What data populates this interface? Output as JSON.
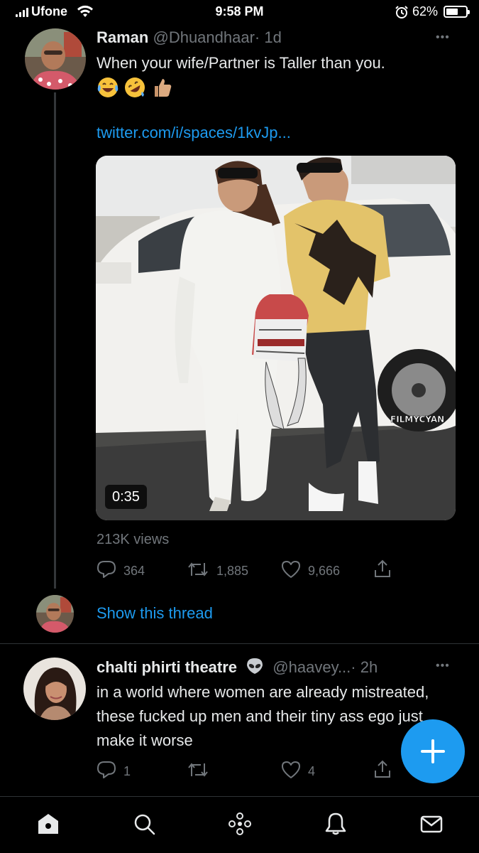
{
  "status_bar": {
    "carrier": "Ufone",
    "time": "9:58 PM",
    "battery": "62%",
    "battery_level": 0.62
  },
  "tweet": {
    "author_name": "Raman",
    "author_handle": "@Dhuandhaar",
    "age": "· 1d",
    "text": "When your wife/Partner is Taller than you.",
    "emojis": [
      "face-with-tears-of-joy",
      "rolling-on-floor-laughing",
      "thumbs-up"
    ],
    "link": "twitter.com/i/spaces/1kvJp...",
    "media": {
      "watermark": "FILMYCYAN",
      "duration": "0:35"
    },
    "views": "213K views",
    "actions": {
      "replies": "364",
      "retweets": "1,885",
      "likes": "9,666"
    },
    "show_thread": "Show this thread"
  },
  "reply": {
    "author_name": "chalti phirti theatre",
    "author_badge_icon": "alien-emoji",
    "author_handle": "@haavey...",
    "age": "· 2h",
    "text": "in a world where women are already mistreated, these fucked up men and their tiny ass ego just make it worse",
    "actions": {
      "replies": "1",
      "retweets": "",
      "likes": "4"
    }
  },
  "compose_button": "+",
  "colors": {
    "accent": "#1d9bf0",
    "background": "#000000",
    "text": "#e7e9ea",
    "muted": "#71767b"
  },
  "bottom_nav": [
    "home-icon",
    "search-icon",
    "spaces-icon",
    "notifications-icon",
    "messages-icon"
  ]
}
